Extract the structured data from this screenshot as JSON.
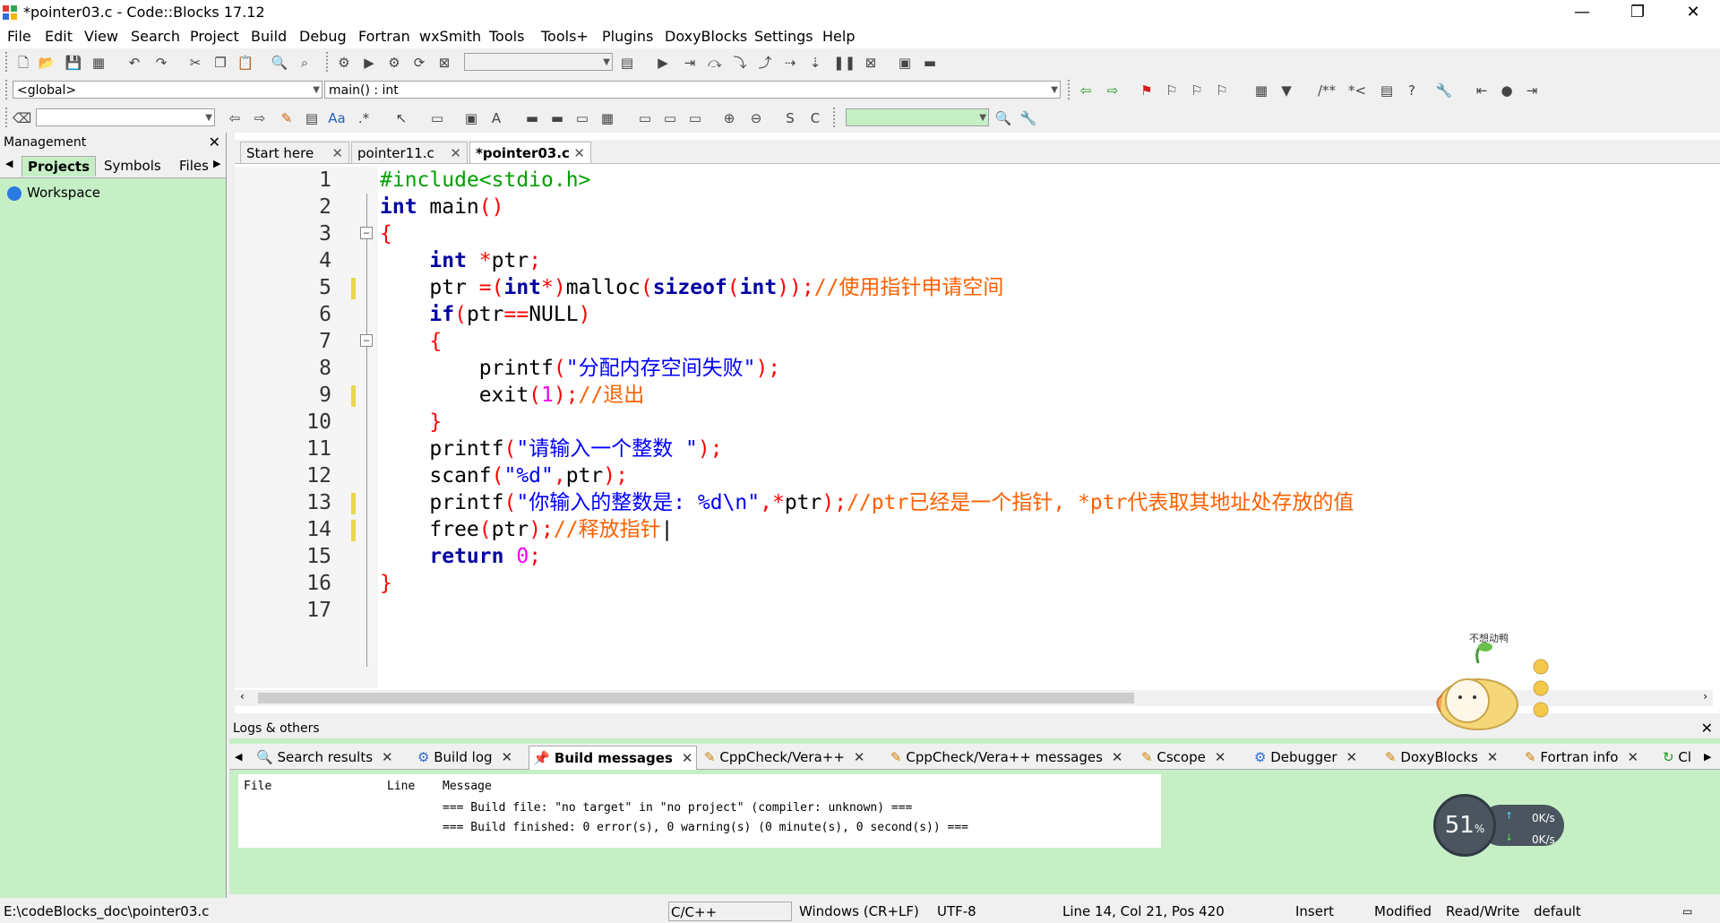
{
  "window": {
    "title": "*pointer03.c - Code::Blocks 17.12",
    "controls": [
      "—",
      "❐",
      "✕"
    ]
  },
  "menu": [
    "File",
    "Edit",
    "View",
    "Search",
    "Project",
    "Build",
    "Debug",
    "Fortran",
    "wxSmith",
    "Tools",
    "Tools+",
    "Plugins",
    "DoxyBlocks",
    "Settings",
    "Help"
  ],
  "toolbar": {
    "scope_combo": "<global>",
    "function_combo": "main() : int",
    "search_combo": ""
  },
  "management": {
    "title": "Management",
    "tabs": [
      "Projects",
      "Symbols",
      "Files"
    ],
    "tree_root": "Workspace"
  },
  "editor": {
    "tabs": [
      "Start here",
      "pointer11.c",
      "*pointer03.c"
    ],
    "lines": [
      "1",
      "2",
      "3",
      "4",
      "5",
      "6",
      "7",
      "8",
      "9",
      "10",
      "11",
      "12",
      "13",
      "14",
      "15",
      "16",
      "17"
    ]
  },
  "logs": {
    "title": "Logs & others",
    "tabs": [
      "Search results",
      "Build log",
      "Build messages",
      "CppCheck/Vera++",
      "CppCheck/Vera++ messages",
      "Cscope",
      "Debugger",
      "DoxyBlocks",
      "Fortran info",
      "Cl"
    ],
    "columns": [
      "File",
      "Line",
      "Message"
    ],
    "messages": [
      "=== Build file: \"no target\" in \"no project\" (compiler: unknown) ===",
      "=== Build finished: 0 error(s), 0 warning(s) (0 minute(s), 0 second(s)) ==="
    ]
  },
  "status": {
    "path": "E:\\codeBlocks_doc\\pointer03.c",
    "language": "C/C++",
    "eol": "Windows (CR+LF)",
    "encoding": "UTF-8",
    "position": "Line 14, Col 21, Pos 420",
    "mode": "Insert",
    "modified": "Modified",
    "rw": "Read/Write",
    "profile": "default"
  },
  "net_widget": {
    "percent": "51",
    "unit": "%",
    "up": "0K/s",
    "down": "0K/s"
  },
  "sticker_text": "不想动鸭",
  "colors": {
    "panel_bg": "#c6efc6",
    "keyword": "#0000a0",
    "string": "#0000ff",
    "comment": "#ff5f00",
    "number": "#f000f0",
    "preprocessor": "#00a000"
  }
}
